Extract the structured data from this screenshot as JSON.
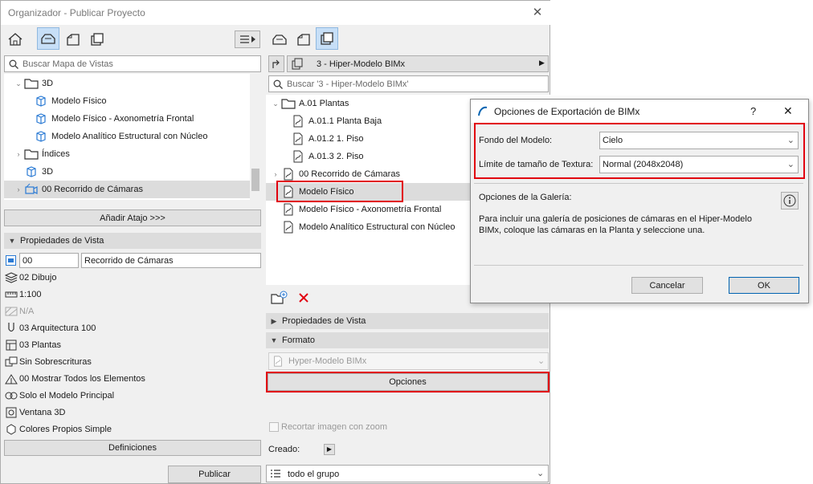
{
  "window": {
    "title": "Organizador - Publicar Proyecto",
    "close_glyph": "✕"
  },
  "left": {
    "search_placeholder": "Buscar Mapa de Vistas",
    "tree": [
      {
        "label": "3D",
        "icon": "folder-icon",
        "arrow": "⌄"
      },
      {
        "label": "Modelo Físico",
        "icon": "cube-icon"
      },
      {
        "label": "Modelo Físico - Axonometría Frontal",
        "icon": "cube-icon"
      },
      {
        "label": "Modelo Analítico Estructural con Núcleo",
        "icon": "cube-icon"
      },
      {
        "label": "Índices",
        "icon": "folder-icon",
        "arrow": "›"
      },
      {
        "label": "3D",
        "icon": "cube-icon"
      },
      {
        "label": "00 Recorrido de Cámaras",
        "icon": "camera-path-icon",
        "arrow": "›"
      }
    ],
    "add_shortcut": "Añadir Atajo >>>",
    "view_props_header": "Propiedades de Vista",
    "id_value": "00",
    "name_value": "Recorrido de Cámaras",
    "props": [
      {
        "label": "02 Dibujo",
        "icon": "layers-icon"
      },
      {
        "label": "1:100",
        "icon": "scale-icon"
      },
      {
        "label": "N/A",
        "icon": "structure-icon",
        "disabled": true
      },
      {
        "label": "03 Arquitectura 100",
        "icon": "pen-icon"
      },
      {
        "label": "03 Plantas",
        "icon": "model-view-icon"
      },
      {
        "label": "Sin Sobrescrituras",
        "icon": "override-icon"
      },
      {
        "label": "00 Mostrar Todos los Elementos",
        "icon": "renovation-icon"
      },
      {
        "label": "Solo el Modelo Principal",
        "icon": "model-filter-icon"
      },
      {
        "label": "Ventana 3D",
        "icon": "window-3d-icon"
      },
      {
        "label": "Colores Propios Simple",
        "icon": "style-icon"
      }
    ],
    "definitions": "Definiciones",
    "publish": "Publicar"
  },
  "right": {
    "set_name": "3 - Hiper-Modelo BIMx",
    "search_placeholder": "Buscar '3 - Hiper-Modelo BIMx'",
    "tree": [
      {
        "label": "A.01 Plantas",
        "icon": "folder-icon",
        "arrow": "⌄"
      },
      {
        "label": "A.01.1 Planta Baja",
        "icon": "doc-icon"
      },
      {
        "label": "A.01.2 1. Piso",
        "icon": "doc-icon"
      },
      {
        "label": "A.01.3 2. Piso",
        "icon": "doc-icon"
      },
      {
        "label": "00 Recorrido de Cámaras",
        "icon": "doc-icon",
        "arrow": "›"
      },
      {
        "label": "Modelo Físico",
        "icon": "doc-icon"
      },
      {
        "label": "Modelo Físico - Axonometría Frontal",
        "icon": "doc-icon"
      },
      {
        "label": "Modelo Analítico Estructural con Núcleo",
        "icon": "doc-icon"
      }
    ],
    "view_props_header": "Propiedades de Vista",
    "format_header": "Formato",
    "format_value": "Hyper-Modelo BIMx",
    "options_button": "Opciones",
    "crop_label": "Recortar imagen con zoom",
    "created_label": "Creado:",
    "group_value": "todo el grupo"
  },
  "dialog": {
    "title": "Opciones de Exportación de BIMx",
    "help": "?",
    "close": "✕",
    "bg_label": "Fondo del Modelo:",
    "bg_value": "Cielo",
    "tex_label": "Límite de tamaño de Textura:",
    "tex_value": "Normal (2048x2048)",
    "gallery_label": "Opciones de la Galería:",
    "gallery_text_1": "Para incluir una galería de posiciones de cámaras en el Hiper-Modelo",
    "gallery_text_2": "BIMx, coloque las cámaras en la Planta y seleccione una.",
    "cancel": "Cancelar",
    "ok": "OK"
  },
  "colors": {
    "highlight": "#e1000f",
    "accent": "#0063b1",
    "active_tab": "#c7dff7"
  }
}
